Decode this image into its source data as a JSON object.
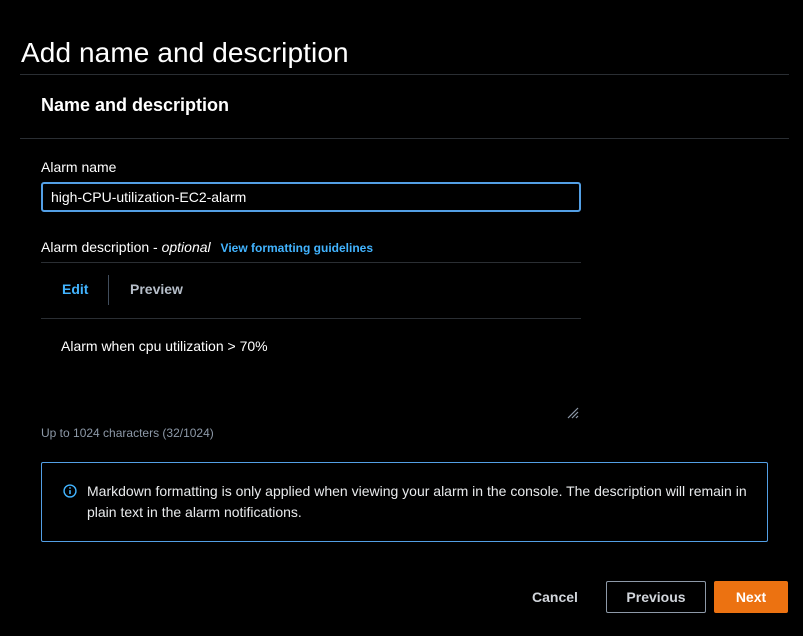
{
  "page": {
    "title": "Add name and description"
  },
  "panel": {
    "header": "Name and description"
  },
  "alarm_name": {
    "label": "Alarm name",
    "value": "high-CPU-utilization-EC2-alarm"
  },
  "alarm_description": {
    "label": "Alarm description - ",
    "optional": "optional",
    "guidelines_link": "View formatting guidelines",
    "tabs": [
      {
        "label": "Edit",
        "active": true
      },
      {
        "label": "Preview",
        "active": false
      }
    ],
    "value": "Alarm when cpu utilization > 70%",
    "char_count": "Up to 1024 characters (32/1024)"
  },
  "info_alert": {
    "icon": "info-icon",
    "text": "Markdown formatting is only applied when viewing your alarm in the console. The description will remain in plain text in the alarm notifications."
  },
  "footer": {
    "cancel_label": "Cancel",
    "previous_label": "Previous",
    "next_label": "Next"
  },
  "colors": {
    "accent_blue": "#42b4ff",
    "focus_border": "#539fe5",
    "primary_button": "#ec7211",
    "background": "#000000"
  }
}
